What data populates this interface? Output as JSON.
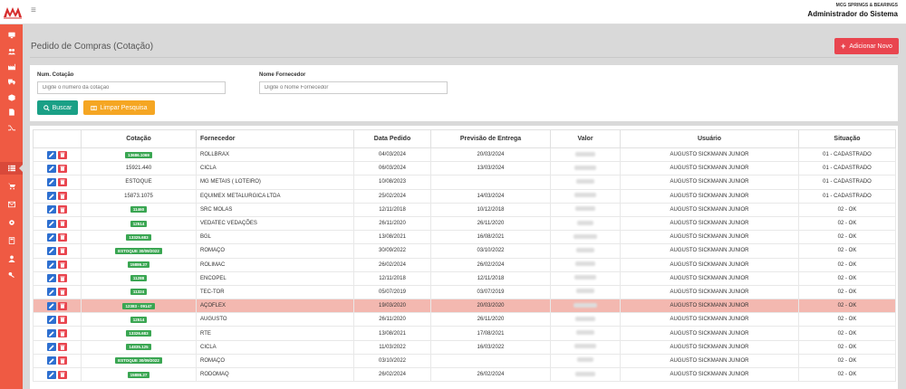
{
  "header": {
    "company": "MCG SPRINGS & BEARINGS",
    "user": "Administrador do Sistema"
  },
  "sidebar": {
    "icons": [
      "monitor-icon",
      "users-icon",
      "industry-icon",
      "truck-icon",
      "box-icon",
      "document-icon",
      "shuffle-icon",
      "list-icon",
      "cart-icon",
      "mail-icon",
      "gear-icon",
      "calculator-icon",
      "user-icon",
      "key-icon"
    ],
    "active_index": 7
  },
  "page": {
    "title": "Pedido de Compras (Cotação)",
    "add_button": "Adicionar Novo"
  },
  "filters": {
    "num_label": "Num. Cotação",
    "num_placeholder": "Digite o número da cotação",
    "supplier_label": "Nome Fornecedor",
    "supplier_placeholder": "Digite o Nome Fornecedor",
    "search_button": "Buscar",
    "clear_button": "Limpar Pesquisa"
  },
  "table": {
    "columns": [
      "",
      "Cotação",
      "Fornecedor",
      "Data Pedido",
      "Previsão de Entrega",
      "Valor",
      "Usuário",
      "Situação"
    ],
    "rows": [
      {
        "cotacao": "13686.1069",
        "badge": true,
        "fornecedor": "ROLLBRAX",
        "data": "04/03/2024",
        "previsao": "20/03/2024",
        "usuario": "AUGUSTO SICKMANN JUNIOR",
        "situacao": "01 - CADASTRADO"
      },
      {
        "cotacao": "15921.440",
        "badge": false,
        "fornecedor": "CICLA",
        "data": "06/03/2024",
        "previsao": "13/03/2024",
        "usuario": "AUGUSTO SICKMANN JUNIOR",
        "situacao": "01 - CADASTRADO"
      },
      {
        "cotacao": "ESTOQUE",
        "badge": false,
        "fornecedor": "MG METAIS ( LOTEIRO)",
        "data": "10/08/2023",
        "previsao": "",
        "usuario": "AUGUSTO SICKMANN JUNIOR",
        "situacao": "01 - CADASTRADO"
      },
      {
        "cotacao": "15873.1075",
        "badge": false,
        "fornecedor": "EQUIMEX METALURGICA LTDA",
        "data": "25/02/2024",
        "previsao": "14/03/2024",
        "usuario": "AUGUSTO SICKMANN JUNIOR",
        "situacao": "01 - CADASTRADO"
      },
      {
        "cotacao": "11460",
        "badge": true,
        "fornecedor": "SRC MOLAS",
        "data": "12/11/2018",
        "previsao": "10/12/2018",
        "usuario": "AUGUSTO SICKMANN JUNIOR",
        "situacao": "02 - OK"
      },
      {
        "cotacao": "12514",
        "badge": true,
        "fornecedor": "VEDATEC VEDAÇÕES",
        "data": "26/11/2020",
        "previsao": "26/11/2020",
        "usuario": "AUGUSTO SICKMANN JUNIOR",
        "situacao": "02 - OK"
      },
      {
        "cotacao": "13325.683",
        "badge": true,
        "fornecedor": "BGL",
        "data": "13/08/2021",
        "previsao": "16/08/2021",
        "usuario": "AUGUSTO SICKMANN JUNIOR",
        "situacao": "02 - OK"
      },
      {
        "cotacao": "ESTOQUE 30/09/2022",
        "badge": true,
        "fornecedor": "ROMAÇO",
        "data": "30/09/2022",
        "previsao": "03/10/2022",
        "usuario": "AUGUSTO SICKMANN JUNIOR",
        "situacao": "02 - OK"
      },
      {
        "cotacao": "15886.27",
        "badge": true,
        "fornecedor": "ROLIMAC",
        "data": "26/02/2024",
        "previsao": "26/02/2024",
        "usuario": "AUGUSTO SICKMANN JUNIOR",
        "situacao": "02 - OK"
      },
      {
        "cotacao": "11288",
        "badge": true,
        "fornecedor": "ENCOPEL",
        "data": "12/11/2018",
        "previsao": "12/11/2018",
        "usuario": "AUGUSTO SICKMANN JUNIOR",
        "situacao": "02 - OK"
      },
      {
        "cotacao": "11324",
        "badge": true,
        "fornecedor": "TEC-TOR",
        "data": "05/07/2019",
        "previsao": "03/07/2019",
        "usuario": "AUGUSTO SICKMANN JUNIOR",
        "situacao": "02 - OK"
      },
      {
        "cotacao": "12383 - 09147",
        "badge": true,
        "fornecedor": "AÇOFLEX",
        "data": "19/03/2020",
        "previsao": "20/03/2020",
        "usuario": "AUGUSTO SICKMANN JUNIOR",
        "situacao": "02 - OK",
        "highlight": true
      },
      {
        "cotacao": "12514",
        "badge": true,
        "fornecedor": "AUGUSTO",
        "data": "26/11/2020",
        "previsao": "26/11/2020",
        "usuario": "AUGUSTO SICKMANN JUNIOR",
        "situacao": "02 - OK"
      },
      {
        "cotacao": "13326.683",
        "badge": true,
        "fornecedor": "RTE",
        "data": "13/08/2021",
        "previsao": "17/08/2021",
        "usuario": "AUGUSTO SICKMANN JUNIOR",
        "situacao": "02 - OK"
      },
      {
        "cotacao": "14835.125",
        "badge": true,
        "fornecedor": "CICLA",
        "data": "11/03/2022",
        "previsao": "16/03/2022",
        "usuario": "AUGUSTO SICKMANN JUNIOR",
        "situacao": "02 - OK"
      },
      {
        "cotacao": "ESTOQUE 30/09/2022",
        "badge": true,
        "fornecedor": "ROMAÇO",
        "data": "03/10/2022",
        "previsao": "",
        "usuario": "AUGUSTO SICKMANN JUNIOR",
        "situacao": "02 - OK"
      },
      {
        "cotacao": "15886.27",
        "badge": true,
        "fornecedor": "RODOMAQ",
        "data": "26/02/2024",
        "previsao": "26/02/2024",
        "usuario": "AUGUSTO SICKMANN JUNIOR",
        "situacao": "02 - OK"
      }
    ]
  },
  "colors": {
    "sidebar": "#ef5a43",
    "add_button": "#e9454f",
    "search_button": "#1aa086",
    "clear_button": "#f5a623",
    "badge": "#3aa652",
    "highlight_row": "#f3b8b0"
  }
}
